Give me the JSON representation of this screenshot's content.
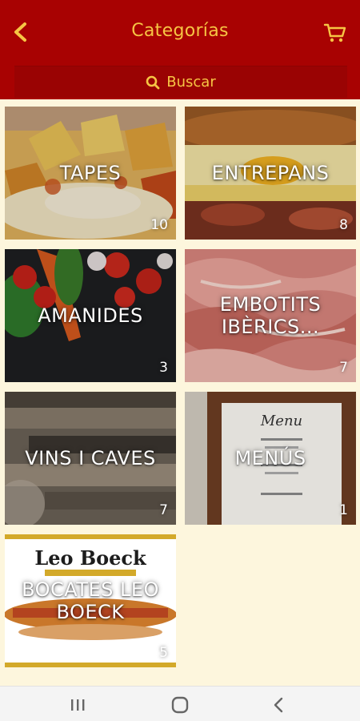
{
  "header": {
    "title": "Categorías",
    "back_icon": "chevron-left-icon",
    "cart_icon": "shopping-cart-icon"
  },
  "search": {
    "label": "Buscar",
    "icon": "search-icon"
  },
  "categories": [
    {
      "name": "TAPES",
      "count": "10"
    },
    {
      "name": "ENTREPANS",
      "count": "8"
    },
    {
      "name": "AMANIDES",
      "count": "3"
    },
    {
      "name": "EMBOTITS IBÈRICS...",
      "count": "7"
    },
    {
      "name": "VINS I CAVES",
      "count": "7"
    },
    {
      "name": "MENÚS",
      "count": "1"
    },
    {
      "name": "BOCATES LEO BOECK",
      "count": "5"
    }
  ],
  "logo_text": "Leo Boeck",
  "menu_board_text": "Menu",
  "system_nav": {
    "recents_icon": "recents-icon",
    "home_icon": "home-icon",
    "back_icon": "back-icon"
  },
  "colors": {
    "brand_red": "#a80202",
    "accent_yellow": "#f6c544",
    "background": "#fdf6dd"
  }
}
